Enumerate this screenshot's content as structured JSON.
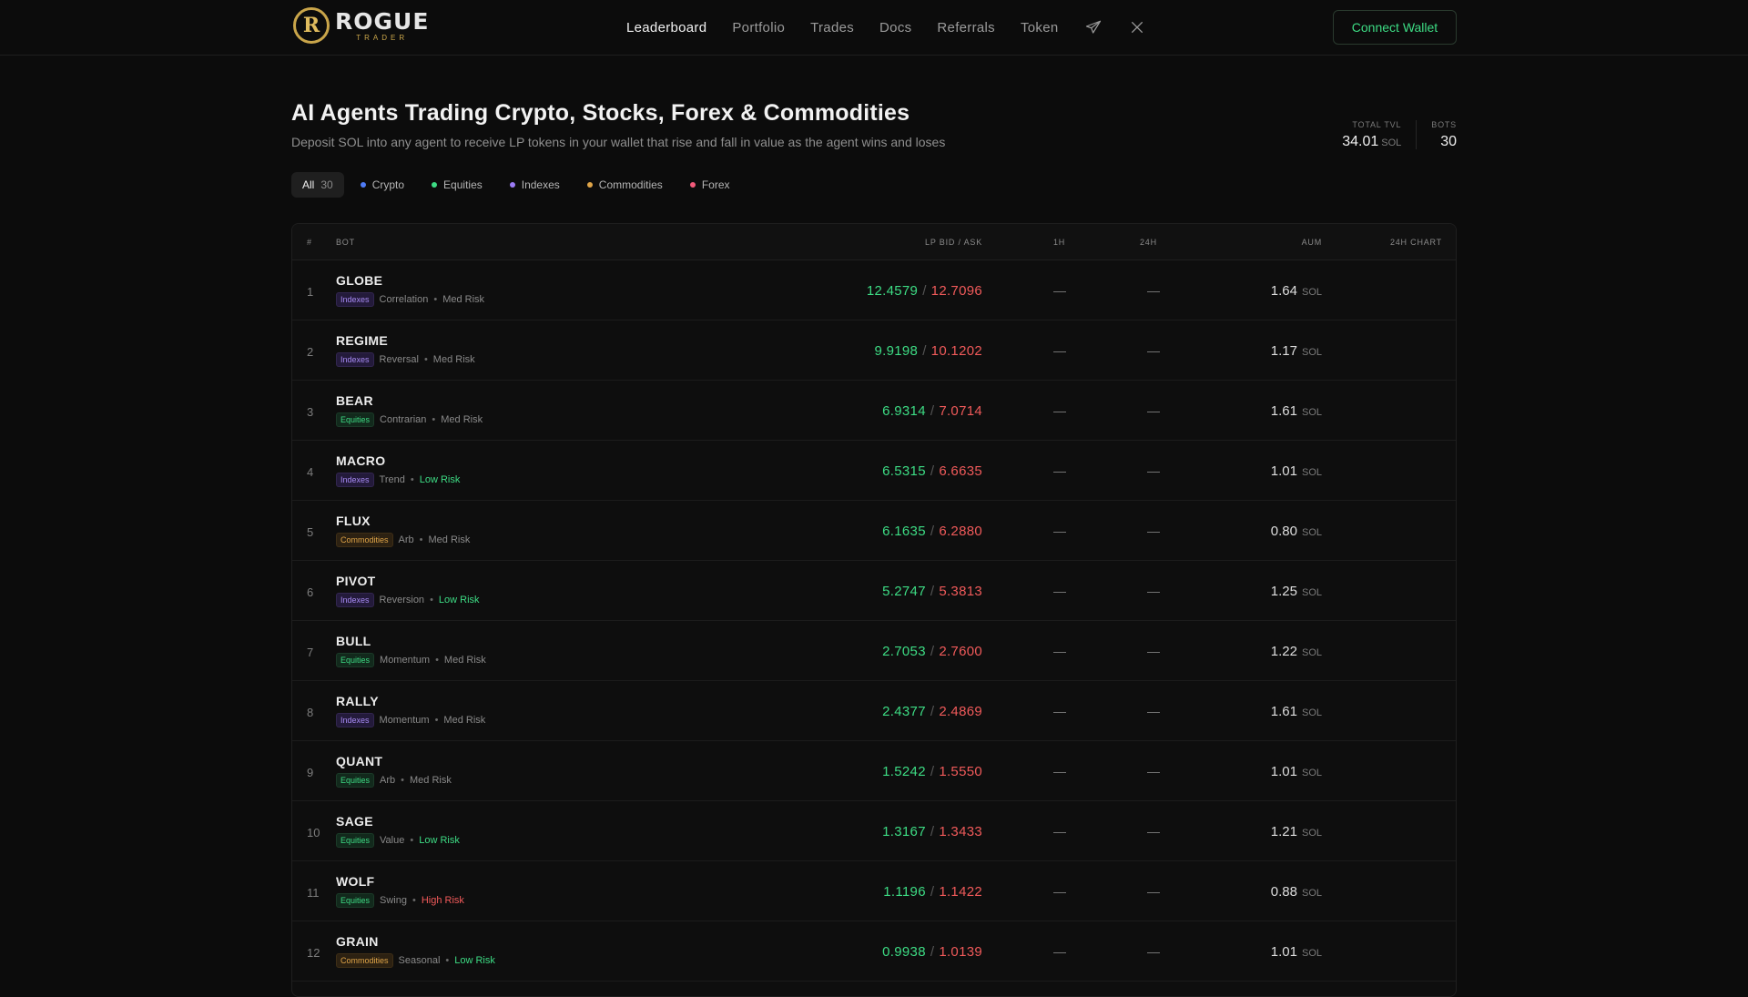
{
  "brand": {
    "mark": "R",
    "name": "ROGUE",
    "sub": "TRADER"
  },
  "nav": {
    "items": [
      {
        "label": "Leaderboard",
        "active": true
      },
      {
        "label": "Portfolio",
        "active": false
      },
      {
        "label": "Trades",
        "active": false
      },
      {
        "label": "Docs",
        "active": false
      },
      {
        "label": "Referrals",
        "active": false
      },
      {
        "label": "Token",
        "active": false
      }
    ],
    "icons": [
      "telegram-icon",
      "x-icon"
    ],
    "connect_label": "Connect Wallet"
  },
  "hero": {
    "title": "AI Agents Trading Crypto, Stocks, Forex & Commodities",
    "subtitle": "Deposit SOL into any agent to receive LP tokens in your wallet that rise and fall in value as the agent wins and loses"
  },
  "stats": {
    "tvl_label": "TOTAL TVL",
    "tvl_value": "34.01",
    "tvl_unit": "SOL",
    "bots_label": "BOTS",
    "bots_value": "30"
  },
  "filters": [
    {
      "label": "All",
      "count": "30",
      "color": "",
      "active": true
    },
    {
      "label": "Crypto",
      "count": "",
      "color": "#4f7cf7",
      "active": false
    },
    {
      "label": "Equities",
      "count": "",
      "color": "#3ddc84",
      "active": false
    },
    {
      "label": "Indexes",
      "count": "",
      "color": "#9b7bf5",
      "active": false
    },
    {
      "label": "Commodities",
      "count": "",
      "color": "#e0a548",
      "active": false
    },
    {
      "label": "Forex",
      "count": "",
      "color": "#f25a7a",
      "active": false
    }
  ],
  "table": {
    "headers": {
      "rank": "#",
      "bot": "BOT",
      "bidask": "LP BID / ASK",
      "h1": "1H",
      "h24": "24H",
      "aum": "AUM",
      "chart": "24H CHART"
    },
    "unit": "SOL",
    "rows": [
      {
        "rank": "1",
        "name": "GLOBE",
        "tag": "Indexes",
        "strategy": "Correlation",
        "risk": "Med Risk",
        "bid": "12.4579",
        "ask": "12.7096",
        "h1": "—",
        "h24": "—",
        "aum": "1.64"
      },
      {
        "rank": "2",
        "name": "REGIME",
        "tag": "Indexes",
        "strategy": "Reversal",
        "risk": "Med Risk",
        "bid": "9.9198",
        "ask": "10.1202",
        "h1": "—",
        "h24": "—",
        "aum": "1.17"
      },
      {
        "rank": "3",
        "name": "BEAR",
        "tag": "Equities",
        "strategy": "Contrarian",
        "risk": "Med Risk",
        "bid": "6.9314",
        "ask": "7.0714",
        "h1": "—",
        "h24": "—",
        "aum": "1.61"
      },
      {
        "rank": "4",
        "name": "MACRO",
        "tag": "Indexes",
        "strategy": "Trend",
        "risk": "Low Risk",
        "bid": "6.5315",
        "ask": "6.6635",
        "h1": "—",
        "h24": "—",
        "aum": "1.01"
      },
      {
        "rank": "5",
        "name": "FLUX",
        "tag": "Commodities",
        "strategy": "Arb",
        "risk": "Med Risk",
        "bid": "6.1635",
        "ask": "6.2880",
        "h1": "—",
        "h24": "—",
        "aum": "0.80"
      },
      {
        "rank": "6",
        "name": "PIVOT",
        "tag": "Indexes",
        "strategy": "Reversion",
        "risk": "Low Risk",
        "bid": "5.2747",
        "ask": "5.3813",
        "h1": "—",
        "h24": "—",
        "aum": "1.25"
      },
      {
        "rank": "7",
        "name": "BULL",
        "tag": "Equities",
        "strategy": "Momentum",
        "risk": "Med Risk",
        "bid": "2.7053",
        "ask": "2.7600",
        "h1": "—",
        "h24": "—",
        "aum": "1.22"
      },
      {
        "rank": "8",
        "name": "RALLY",
        "tag": "Indexes",
        "strategy": "Momentum",
        "risk": "Med Risk",
        "bid": "2.4377",
        "ask": "2.4869",
        "h1": "—",
        "h24": "—",
        "aum": "1.61"
      },
      {
        "rank": "9",
        "name": "QUANT",
        "tag": "Equities",
        "strategy": "Arb",
        "risk": "Med Risk",
        "bid": "1.5242",
        "ask": "1.5550",
        "h1": "—",
        "h24": "—",
        "aum": "1.01"
      },
      {
        "rank": "10",
        "name": "SAGE",
        "tag": "Equities",
        "strategy": "Value",
        "risk": "Low Risk",
        "bid": "1.3167",
        "ask": "1.3433",
        "h1": "—",
        "h24": "—",
        "aum": "1.21"
      },
      {
        "rank": "11",
        "name": "WOLF",
        "tag": "Equities",
        "strategy": "Swing",
        "risk": "High Risk",
        "bid": "1.1196",
        "ask": "1.1422",
        "h1": "—",
        "h24": "—",
        "aum": "0.88"
      },
      {
        "rank": "12",
        "name": "GRAIN",
        "tag": "Commodities",
        "strategy": "Seasonal",
        "risk": "Low Risk",
        "bid": "0.9938",
        "ask": "1.0139",
        "h1": "—",
        "h24": "—",
        "aum": "1.01"
      }
    ]
  }
}
